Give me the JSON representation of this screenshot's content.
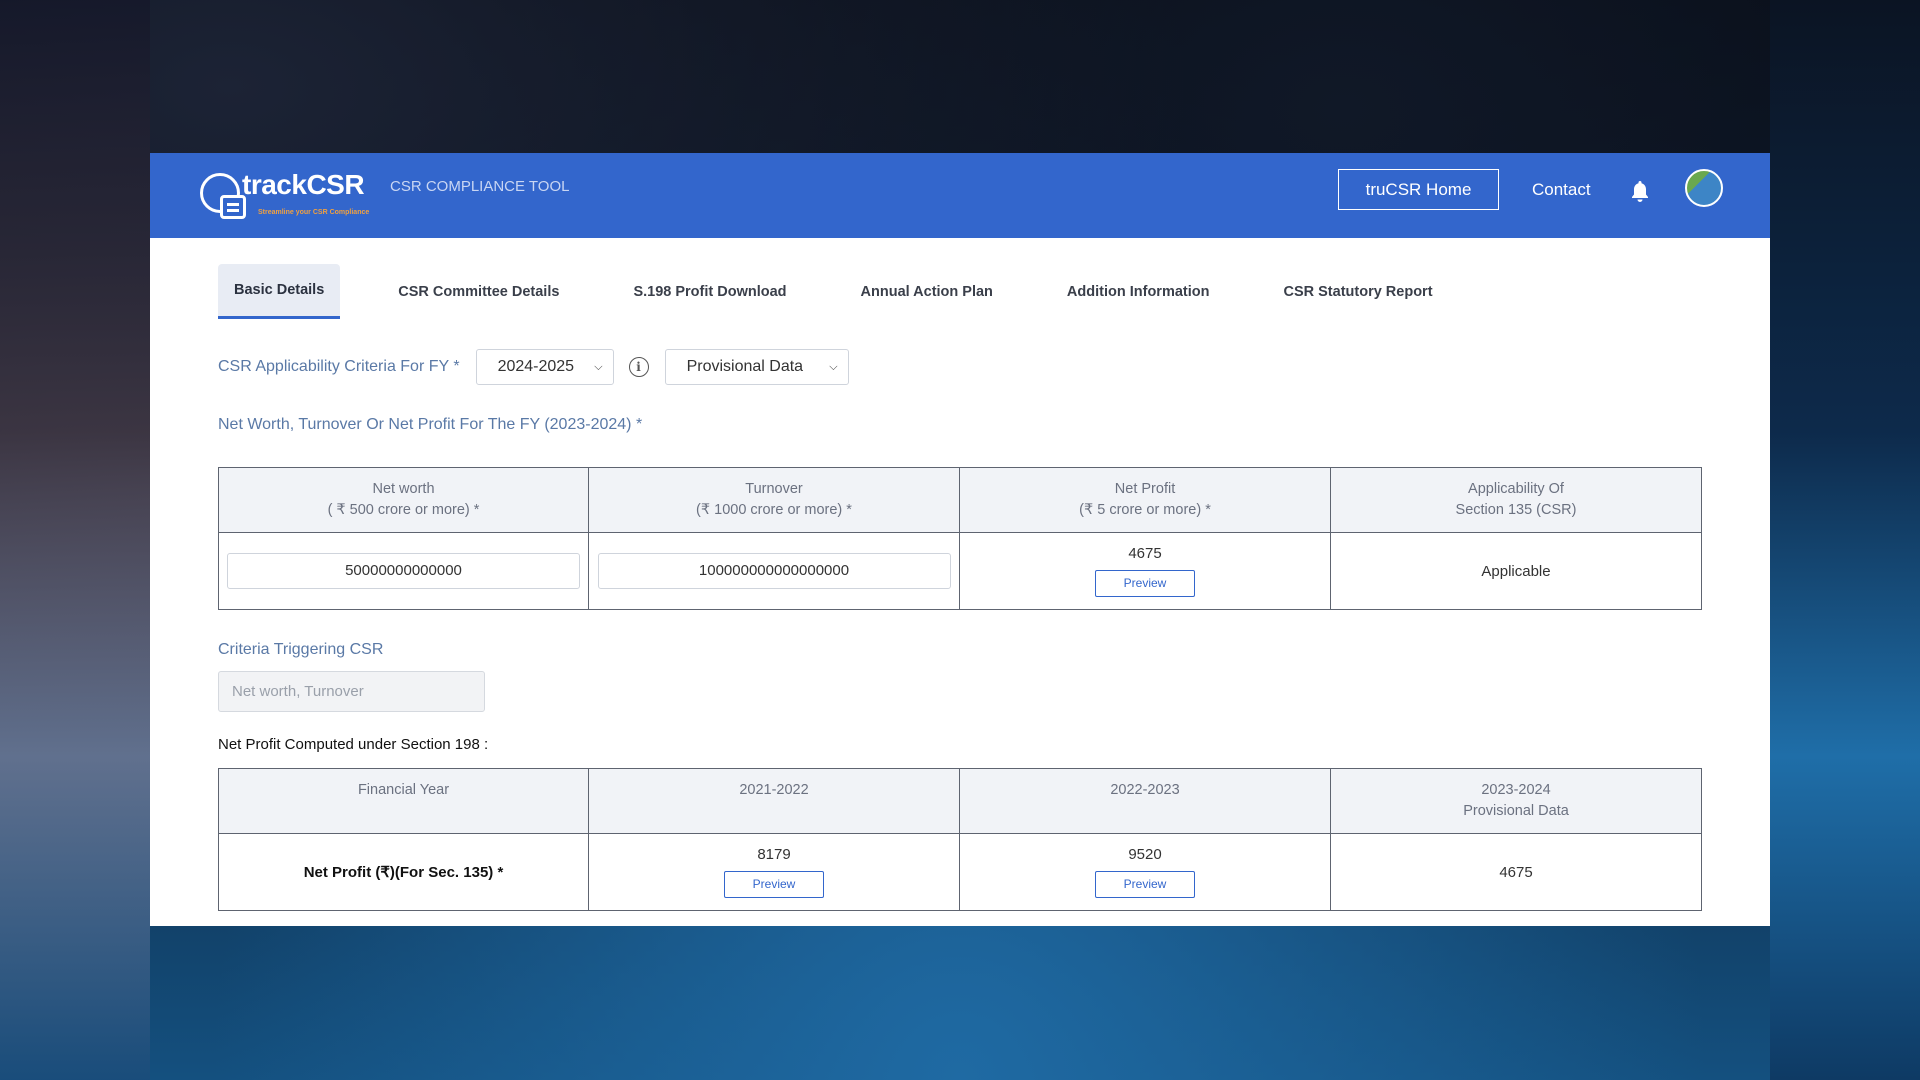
{
  "header": {
    "logo_text": "trackCSR",
    "logo_tagline": "Streamline your CSR Compliance",
    "subtitle": "CSR COMPLIANCE TOOL",
    "home_button": "truCSR Home",
    "contact_link": "Contact",
    "icons": [
      "bell-icon",
      "avatar"
    ]
  },
  "tabs": [
    {
      "label": "Basic Details",
      "active": true
    },
    {
      "label": "CSR Committee Details"
    },
    {
      "label": "S.198 Profit Download"
    },
    {
      "label": "Annual Action Plan"
    },
    {
      "label": "Addition Information"
    },
    {
      "label": "CSR Statutory Report"
    }
  ],
  "criteria": {
    "label": "CSR Applicability Criteria For FY *",
    "fy_selected": "2024-2025",
    "data_type_selected": "Provisional Data"
  },
  "networth_section": {
    "title": "Net Worth, Turnover Or Net Profit For The FY (2023-2024) *",
    "headers": [
      {
        "line1": "Net worth",
        "line2": "( ₹ 500 crore or more) *"
      },
      {
        "line1": "Turnover",
        "line2": "(₹ 1000 crore or more) *"
      },
      {
        "line1": "Net Profit",
        "line2": "(₹ 5 crore or more) *"
      },
      {
        "line1": "Applicability Of",
        "line2": "Section 135 (CSR)"
      }
    ],
    "net_worth_value": "50000000000000",
    "turnover_value": "100000000000000000",
    "net_profit_value": "4675",
    "preview_label": "Preview",
    "applicability": "Applicable"
  },
  "criteria_triggering": {
    "title": "Criteria Triggering CSR",
    "placeholder": "Net worth, Turnover"
  },
  "net_profit_section": {
    "title": "Net Profit Computed under Section 198 :",
    "headers": {
      "col0": "Financial Year",
      "col1": "2021-2022",
      "col2": "2022-2023",
      "col3_line1": "2023-2024",
      "col3_line2": "Provisional Data"
    },
    "row_label": "Net Profit (₹)(For Sec. 135) *",
    "values": [
      "8179",
      "9520",
      "4675"
    ],
    "preview_label": "Preview"
  },
  "colors": {
    "header_bg": "#3366cc",
    "accent": "#3366cc",
    "label_blue": "#5a79a6"
  }
}
